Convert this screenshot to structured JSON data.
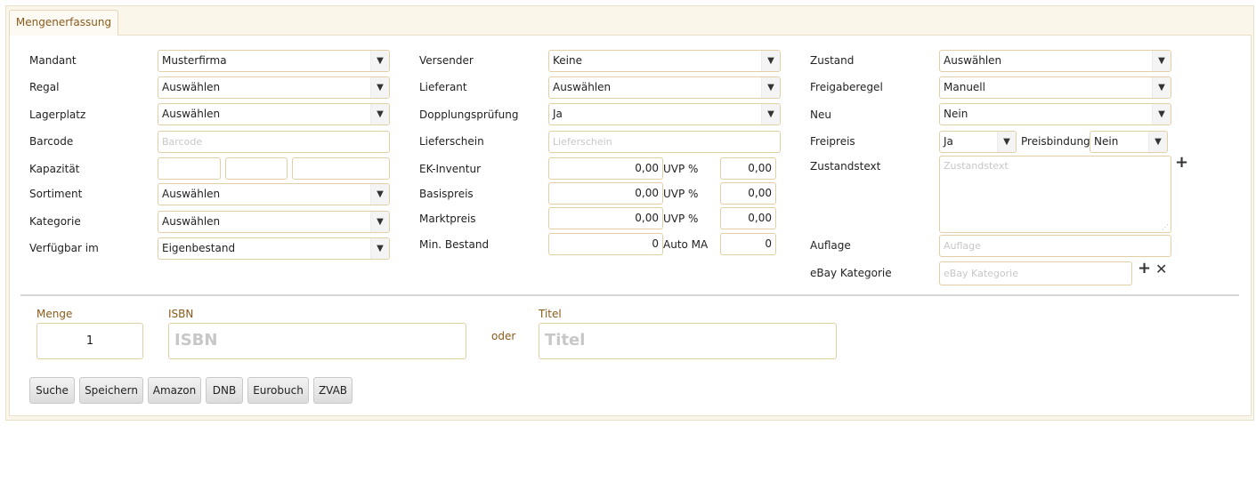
{
  "tab": {
    "label": "Mengenerfassung"
  },
  "col1": {
    "mandant": {
      "label": "Mandant",
      "value": "Musterfirma"
    },
    "regal": {
      "label": "Regal",
      "value": "Auswählen"
    },
    "lagerplatz": {
      "label": "Lagerplatz",
      "value": "Auswählen"
    },
    "barcode": {
      "label": "Barcode",
      "placeholder": "Barcode"
    },
    "kapazitaet": {
      "label": "Kapazität"
    },
    "sortiment": {
      "label": "Sortiment",
      "value": "Auswählen"
    },
    "kategorie": {
      "label": "Kategorie",
      "value": "Auswählen"
    },
    "verfuegbar": {
      "label": "Verfügbar im",
      "value": "Eigenbestand"
    }
  },
  "col2": {
    "versender": {
      "label": "Versender",
      "value": "Keine"
    },
    "lieferant": {
      "label": "Lieferant",
      "value": "Auswählen"
    },
    "dopplung": {
      "label": "Dopplungsprüfung",
      "value": "Ja"
    },
    "lieferschein": {
      "label": "Lieferschein",
      "placeholder": "Lieferschein"
    },
    "ek": {
      "label": "EK-Inventur",
      "value": "0,00",
      "uvp_label": "UVP %",
      "uvp_value": "0,00"
    },
    "basis": {
      "label": "Basispreis",
      "value": "0,00",
      "uvp_label": "UVP %",
      "uvp_value": "0,00"
    },
    "markt": {
      "label": "Marktpreis",
      "value": "0,00",
      "uvp_label": "UVP %",
      "uvp_value": "0,00"
    },
    "minbestand": {
      "label": "Min. Bestand",
      "value": "0",
      "auto_label": "Auto MA",
      "auto_value": "0"
    }
  },
  "col3": {
    "zustand": {
      "label": "Zustand",
      "value": "Auswählen"
    },
    "freigabe": {
      "label": "Freigaberegel",
      "value": "Manuell"
    },
    "neu": {
      "label": "Neu",
      "value": "Nein"
    },
    "freipreis": {
      "label": "Freipreis",
      "value": "Ja",
      "preisbindung_label": "Preisbindung",
      "preisbindung_value": "Nein"
    },
    "zustandstext": {
      "label": "Zustandstext",
      "placeholder": "Zustandstext"
    },
    "auflage": {
      "label": "Auflage",
      "placeholder": "Auflage"
    },
    "ebay": {
      "label": "eBay Kategorie",
      "placeholder": "eBay Kategorie"
    }
  },
  "icons": {
    "add": "+",
    "remove": "✕",
    "dropdown": "▼",
    "resize": "⋰"
  },
  "search": {
    "menge": {
      "label": "Menge",
      "value": "1"
    },
    "isbn": {
      "label": "ISBN",
      "placeholder": "ISBN"
    },
    "oder": "oder",
    "titel": {
      "label": "Titel",
      "placeholder": "Titel"
    }
  },
  "buttons": [
    "Suche",
    "Speichern",
    "Amazon",
    "DNB",
    "Eurobuch",
    "ZVAB"
  ]
}
